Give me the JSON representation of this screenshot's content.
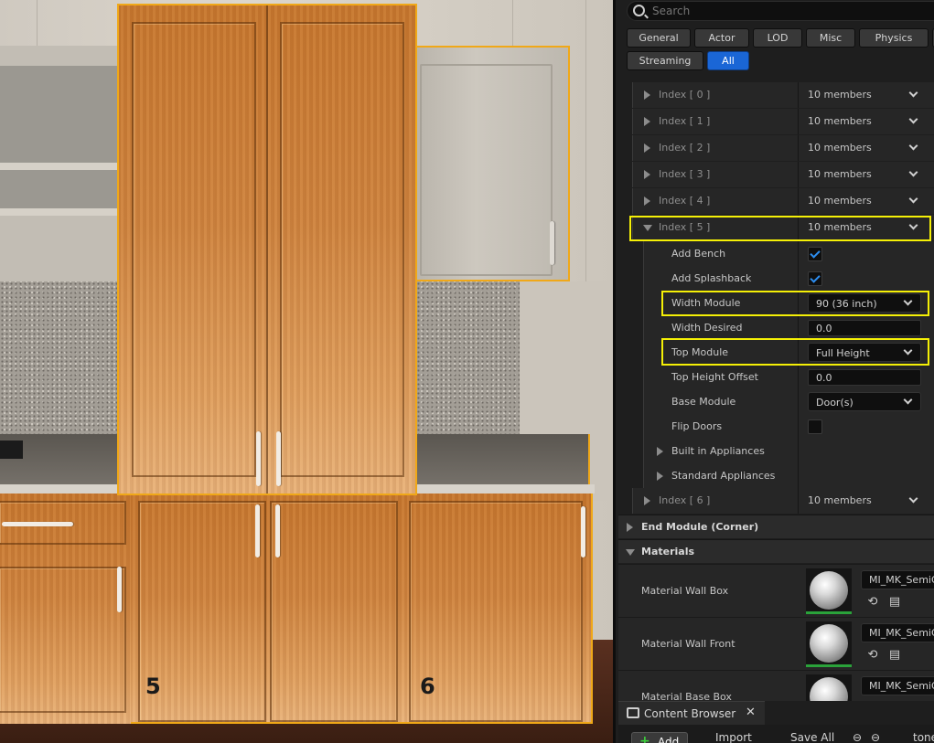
{
  "viewport": {
    "module_labels": [
      "5",
      "6"
    ]
  },
  "search": {
    "placeholder": "Search"
  },
  "filters": {
    "row1": [
      "General",
      "Actor",
      "LOD",
      "Misc",
      "Physics"
    ],
    "row2": [
      "Streaming",
      "All"
    ],
    "active": "All"
  },
  "details": {
    "indices": [
      {
        "label": "Index [ 0 ]",
        "value": "10 members"
      },
      {
        "label": "Index [ 1 ]",
        "value": "10 members"
      },
      {
        "label": "Index [ 2 ]",
        "value": "10 members"
      },
      {
        "label": "Index [ 3 ]",
        "value": "10 members"
      },
      {
        "label": "Index [ 4 ]",
        "value": "10 members"
      },
      {
        "label": "Index [ 5 ]",
        "value": "10 members"
      },
      {
        "label": "Index [ 6 ]",
        "value": "10 members"
      }
    ],
    "index5": {
      "add_bench": {
        "label": "Add Bench",
        "checked": true
      },
      "add_splashback": {
        "label": "Add Splashback",
        "checked": true
      },
      "width_module": {
        "label": "Width Module",
        "value": "90 (36 inch)"
      },
      "width_desired": {
        "label": "Width Desired",
        "value": "0.0"
      },
      "top_module": {
        "label": "Top Module",
        "value": "Full Height"
      },
      "top_height_offset": {
        "label": "Top Height Offset",
        "value": "0.0"
      },
      "base_module": {
        "label": "Base Module",
        "value": "Door(s)"
      },
      "flip_doors": {
        "label": "Flip Doors",
        "checked": false
      },
      "built_in_appliances": {
        "label": "Built in Appliances"
      },
      "standard_appliances": {
        "label": "Standard Appliances"
      }
    },
    "sections": {
      "end_module": "End Module (Corner)",
      "materials": "Materials"
    },
    "materials": [
      {
        "label": "Material Wall Box",
        "value": "MI_MK_SemiGl"
      },
      {
        "label": "Material Wall Front",
        "value": "MI_MK_SemiGl"
      },
      {
        "label": "Material Base Box",
        "value": "MI_MK_SemiGl"
      }
    ]
  },
  "content_browser": {
    "tab_label": "Content Browser",
    "close": "✕",
    "add": "Add",
    "import": "Import",
    "save_all": "Save All",
    "path": "tone"
  },
  "colors": {
    "highlight": "#f5f006",
    "accent": "#1a66d6",
    "selection_outline": "#f0a818"
  }
}
